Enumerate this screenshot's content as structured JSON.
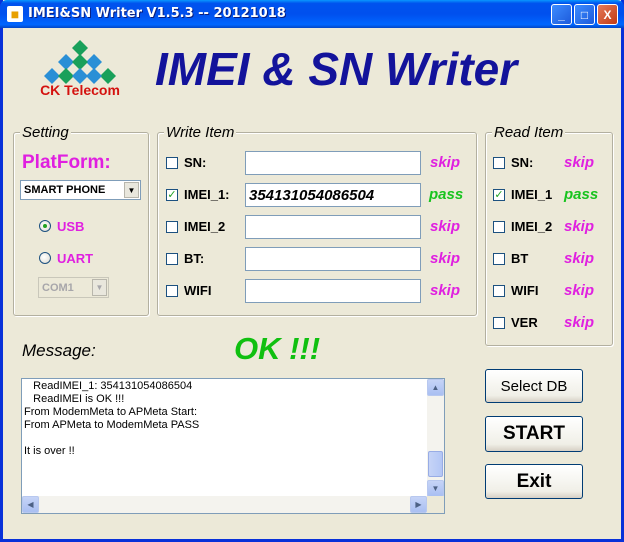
{
  "window": {
    "title": "IMEI&SN Writer V1.5.3 -- 20121018",
    "minimize": "_",
    "maximize": "□",
    "close": "X"
  },
  "header": {
    "logo_text": "CK Telecom",
    "title": "IMEI & SN Writer"
  },
  "setting": {
    "legend": "Setting",
    "platform_label": "PlatForm:",
    "platform_value": "SMART PHONE",
    "usb_label": "USB",
    "uart_label": "UART",
    "com_port": "COM1",
    "connection": "USB"
  },
  "write_item": {
    "legend": "Write Item",
    "rows": [
      {
        "label": "SN:",
        "checked": false,
        "value": "",
        "status": "skip"
      },
      {
        "label": "IMEI_1:",
        "checked": true,
        "value": "354131054086504",
        "status": "pass"
      },
      {
        "label": "IMEI_2",
        "checked": false,
        "value": "",
        "status": "skip"
      },
      {
        "label": "BT:",
        "checked": false,
        "value": "",
        "status": "skip"
      },
      {
        "label": "WIFI",
        "checked": false,
        "value": "",
        "status": "skip"
      }
    ]
  },
  "read_item": {
    "legend": "Read Item",
    "rows": [
      {
        "label": "SN:",
        "checked": false,
        "status": "skip"
      },
      {
        "label": "IMEI_1",
        "checked": true,
        "status": "pass"
      },
      {
        "label": "IMEI_2",
        "checked": false,
        "status": "skip"
      },
      {
        "label": "BT",
        "checked": false,
        "status": "skip"
      },
      {
        "label": "WIFI",
        "checked": false,
        "status": "skip"
      },
      {
        "label": "VER",
        "checked": false,
        "status": "skip"
      }
    ]
  },
  "message": {
    "label": "Message:",
    "result": "OK !!!",
    "lines": [
      "   ReadIMEI_1: 354131054086504",
      "   ReadIMEI is OK !!!",
      "From ModemMeta to APMeta Start:",
      "From APMeta to ModemMeta PASS",
      "",
      "It is over !!"
    ]
  },
  "buttons": {
    "select_db": "Select DB",
    "start": "START",
    "exit": "Exit"
  },
  "colors": {
    "accent_magenta": "#e020e0",
    "pass_green": "#19c41f",
    "title_blue": "#13139b",
    "logo_red": "#d4120f"
  }
}
